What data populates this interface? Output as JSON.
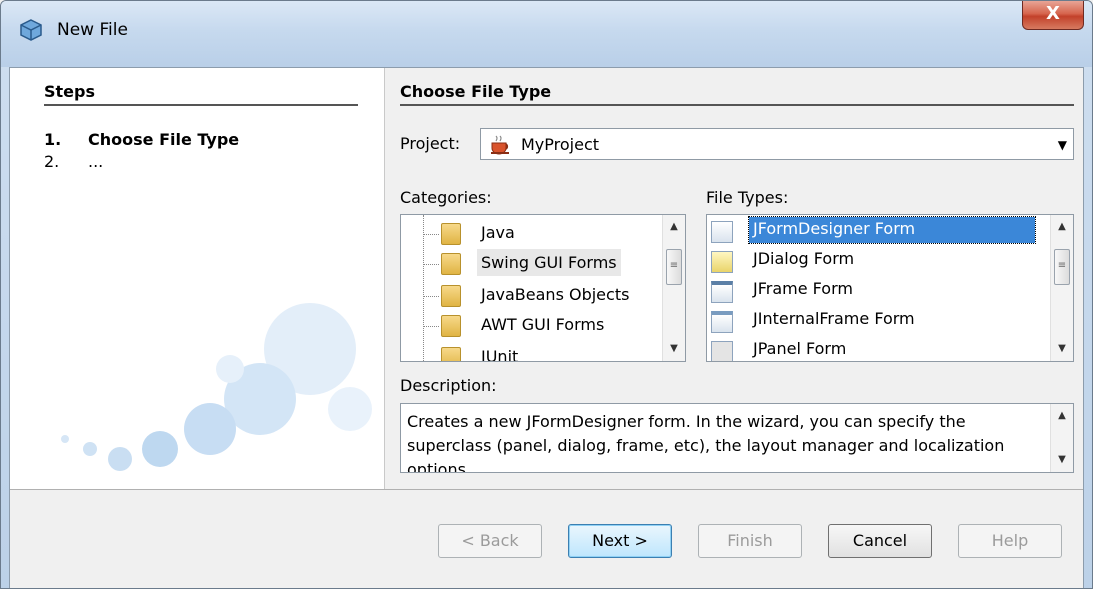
{
  "window": {
    "title": "New File",
    "close_label": "X"
  },
  "steps": {
    "title": "Steps",
    "items": [
      {
        "num": "1.",
        "label": "Choose File Type"
      },
      {
        "num": "2.",
        "label": "..."
      }
    ]
  },
  "main": {
    "title": "Choose File Type",
    "project_label": "Project:",
    "project_value": "MyProject",
    "categories_label": "Categories:",
    "categories": [
      "Java",
      "Swing GUI Forms",
      "JavaBeans Objects",
      "AWT GUI Forms",
      "JUnit"
    ],
    "file_types_label": "File Types:",
    "file_types": [
      "JFormDesigner Form",
      "JDialog Form",
      "JFrame Form",
      "JInternalFrame Form",
      "JPanel Form"
    ],
    "description_label": "Description:",
    "description": "Creates a new JFormDesigner form. In the wizard, you can specify the superclass (panel, dialog, frame, etc), the layout manager and localization options."
  },
  "buttons": {
    "back": "< Back",
    "next": "Next >",
    "finish": "Finish",
    "cancel": "Cancel",
    "help": "Help"
  },
  "colors": {
    "selection": "#3b87d8",
    "accent": "#3c7fb1"
  }
}
